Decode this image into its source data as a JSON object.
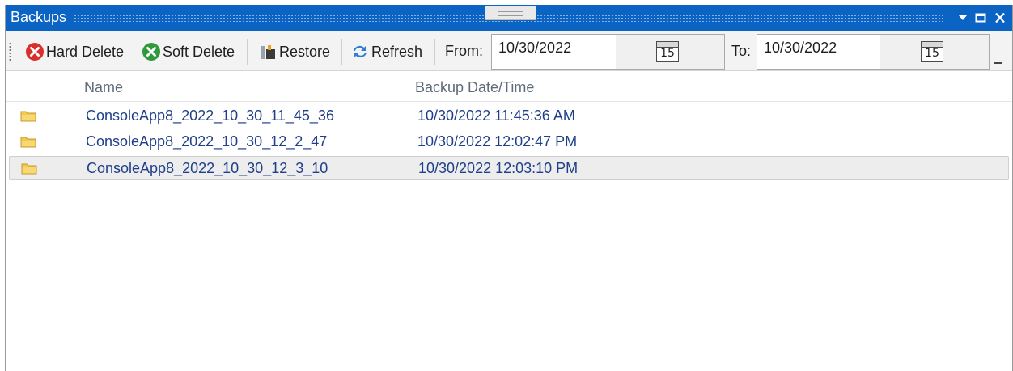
{
  "window": {
    "title": "Backups"
  },
  "toolbar": {
    "hard_delete": "Hard Delete",
    "soft_delete": "Soft Delete",
    "restore": "Restore",
    "refresh": "Refresh",
    "from_label": "From:",
    "from_value": "10/30/2022",
    "to_label": "To:",
    "to_value": "10/30/2022",
    "calendar_day": "15"
  },
  "list": {
    "columns": [
      "Name",
      "Backup Date/Time"
    ],
    "rows": [
      {
        "name": "ConsoleApp8_2022_10_30_11_45_36",
        "datetime": "10/30/2022 11:45:36 AM",
        "selected": false
      },
      {
        "name": "ConsoleApp8_2022_10_30_12_2_47",
        "datetime": "10/30/2022 12:02:47 PM",
        "selected": false
      },
      {
        "name": "ConsoleApp8_2022_10_30_12_3_10",
        "datetime": "10/30/2022 12:03:10 PM",
        "selected": true
      }
    ]
  },
  "colors": {
    "titlebar": "#0b64c4",
    "hard_delete_icon": "#d9302c",
    "soft_delete_icon": "#2e9a3c",
    "folder": "#f2c94c",
    "row_text": "#1f3f8a"
  },
  "icons": [
    "dropdown-arrow-icon",
    "maximize-icon",
    "close-icon",
    "hard-delete-icon",
    "soft-delete-icon",
    "restore-icon",
    "refresh-icon",
    "calendar-icon",
    "folder-icon"
  ]
}
